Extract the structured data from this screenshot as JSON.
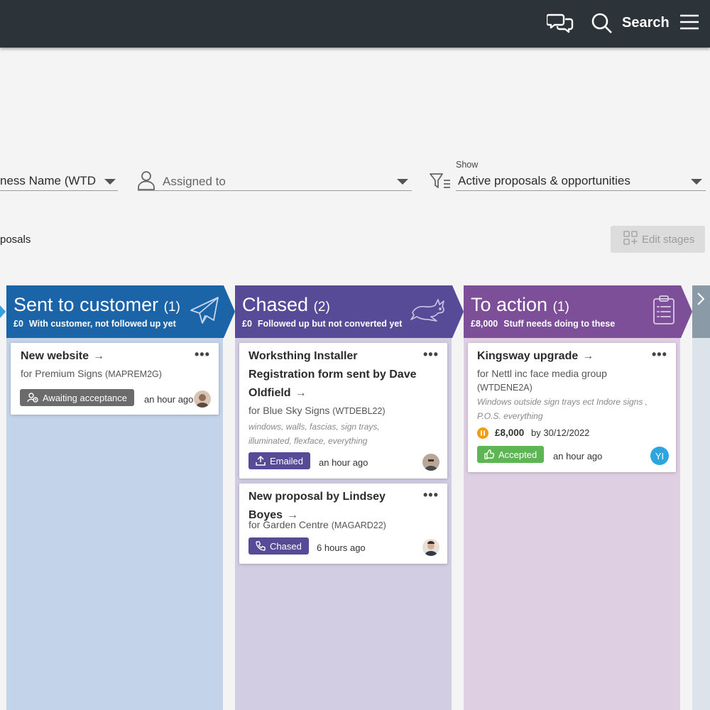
{
  "topbar": {
    "search_label": "Search"
  },
  "filters": {
    "business_value": "ness Name (WTD",
    "assigned_placeholder": "Assigned to",
    "show_label": "Show",
    "show_value": "Active proposals & opportunities"
  },
  "toolbar": {
    "proposals_label": "posals",
    "edit_stages_label": "Edit stages"
  },
  "stages": [
    {
      "title": "Sent to customer",
      "count": "(1)",
      "amount": "£0",
      "description": "With customer, not followed up yet",
      "color": "#1b64a8",
      "bg": "#c3d3ea"
    },
    {
      "title": "Chased",
      "count": "(2)",
      "amount": "£0",
      "description": "Followed up but not converted yet",
      "color": "#574a97",
      "bg": "#d3cde3"
    },
    {
      "title": "To action",
      "count": "(1)",
      "amount": "£8,000",
      "description": "Stuff needs doing to these",
      "color": "#7c4f98",
      "bg": "#decfe3"
    }
  ],
  "cards": {
    "new_website": {
      "title": "New website",
      "arrow": "→",
      "for": "for Premium Signs",
      "code": "(MAPREM2G)",
      "badge": "Awaiting acceptance",
      "ago": "an hour ago"
    },
    "worksthing": {
      "title": "Worksthing Installer Registration form sent by Dave Oldfield",
      "arrow": "→",
      "for": "for Blue Sky Signs",
      "code": "(WTDEBL22)",
      "desc": "windows, walls, fascias, sign trays, illuminated, flexface, everything",
      "badge": "Emailed",
      "ago": "an hour ago"
    },
    "new_proposal": {
      "title": "New proposal by Lindsey Boyes",
      "arrow": "→",
      "for": "for Garden Centre",
      "code": "(MAGARD22)",
      "badge": "Chased",
      "ago": "6 hours ago"
    },
    "kingsway": {
      "title": "Kingsway upgrade",
      "arrow": "→",
      "for": "for Nettl inc face media group",
      "code": "(WTDENE2A)",
      "desc": "Windows outside sign trays ect Indore signs , P.O.S. everything",
      "value": "£8,000",
      "due": "by 30/12/2022",
      "badge": "Accepted",
      "ago": "an hour ago",
      "initials": "YI"
    }
  },
  "colors": {
    "topbar": "#2c343a",
    "badge_gray": "#6b6b6b",
    "badge_purple": "#574a97",
    "badge_green": "#5db554",
    "status_orange": "#f39c12",
    "avatar_blue": "#2ba6de"
  },
  "icons": [
    "chat-icon",
    "search-icon",
    "hamburger-menu-icon",
    "person-icon",
    "filter-icon",
    "edit-stages-icon",
    "paper-plane-icon",
    "running-rabbit-icon",
    "clipboard-icon",
    "chevron-right-icon",
    "user-clock-icon",
    "upload-icon",
    "phone-icon",
    "thumbs-up-icon",
    "pause-icon"
  ]
}
